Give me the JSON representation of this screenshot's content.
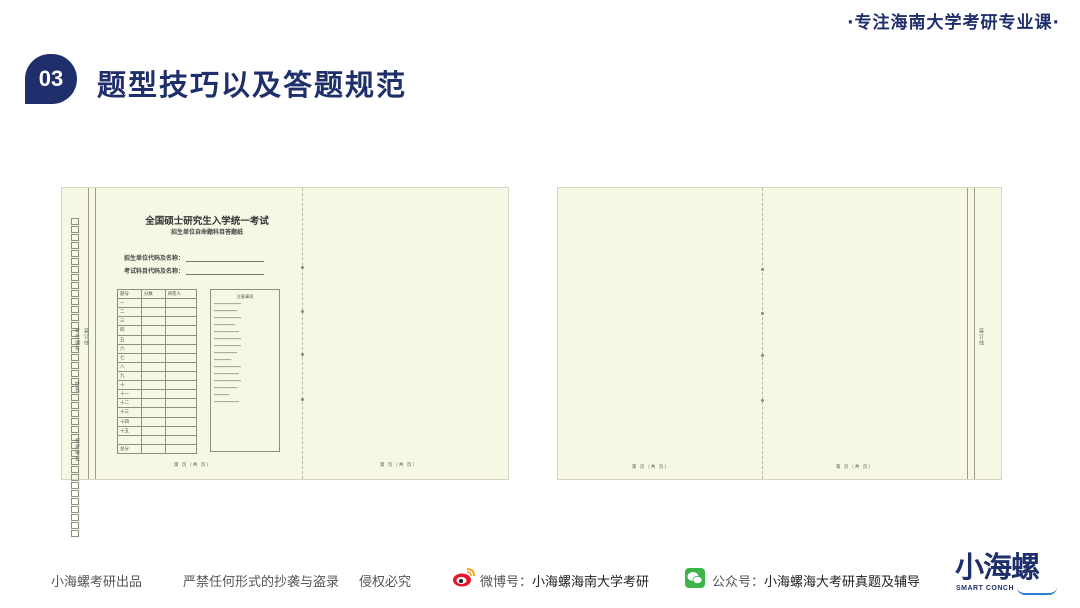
{
  "header": {
    "tagline": "·专注海南大学考研专业课·",
    "section_number": "03",
    "section_title": "题型技巧以及答题规范"
  },
  "answer_sheet": {
    "title": "全国硕士研究生入学统一考试",
    "subtitle": "招生单位自命题科目答题纸",
    "field_unit": "招生单位代码及名称：",
    "field_subject": "考试科目代码及名称：",
    "score_table": {
      "headers": [
        "题号",
        "分数",
        "阅卷人"
      ],
      "rows": [
        "一",
        "二",
        "三",
        "四",
        "五",
        "六",
        "七",
        "八",
        "九",
        "十",
        "十一",
        "十二",
        "十三",
        "十四",
        "十五",
        "",
        "总分"
      ]
    },
    "notes_title": "注意事项",
    "side_labels": {
      "left_vertical_1": "考生编号",
      "left_vertical_2": "姓名",
      "left_vertical_3": "报考单位",
      "left_vertical_4": "装订线"
    },
    "page_footer_left": "第  页（共  页）",
    "page_footer_right": "第  页（共  页）",
    "page_footer_r1": "第  页（共  页）",
    "page_footer_r2": "第  页（共  页）"
  },
  "footer": {
    "producer": "小海螺考研出品",
    "copyright": "严禁任何形式的抄袭与盗录",
    "rights": "侵权必究",
    "weibo_label": "微博号：",
    "weibo_name": "小海螺海南大学考研",
    "wechat_label": "公众号：",
    "wechat_name": "小海螺海大考研真题及辅导",
    "logo_text": "小海螺",
    "logo_sub": "SMART CONCH"
  },
  "colors": {
    "brand_navy": "#1f2f6b",
    "paper": "#f7f7e6",
    "wechat_green": "#3bb54a",
    "weibo_red": "#e6162d"
  }
}
